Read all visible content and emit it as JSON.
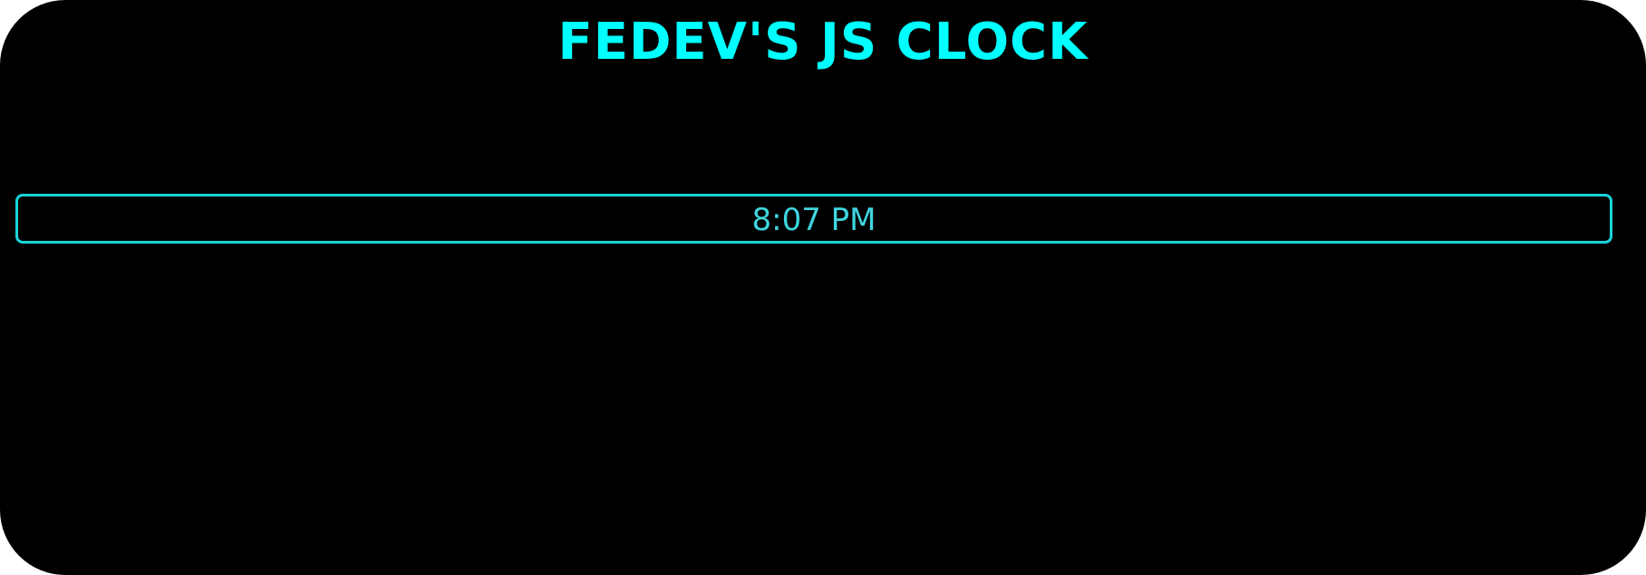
{
  "header": {
    "title": "FEDEV'S JS CLOCK"
  },
  "clock": {
    "time": "8:07 PM"
  },
  "colors": {
    "background": "#000000",
    "accent": "#00ffff",
    "clock_border": "#19d3da",
    "clock_text": "#3fd6e0"
  }
}
